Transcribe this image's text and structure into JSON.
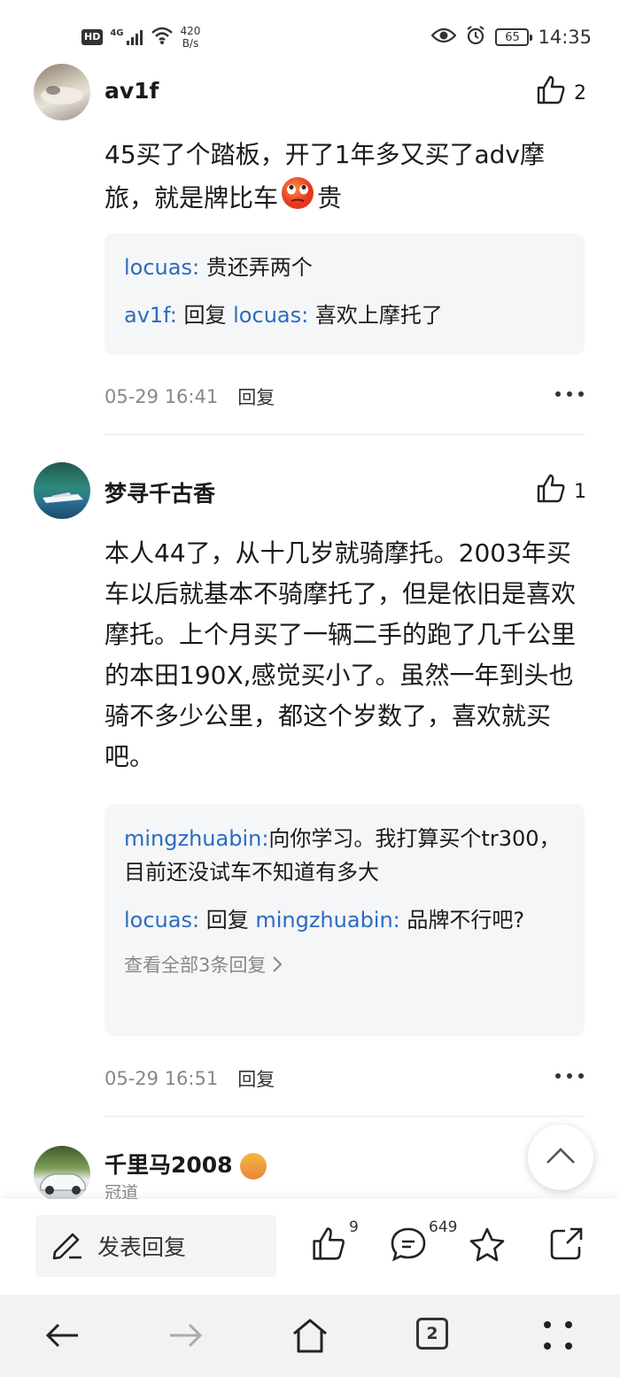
{
  "status_bar": {
    "hd": "HD",
    "signal": "4G",
    "speed_value": "420",
    "speed_unit": "B/s",
    "battery": "65",
    "time": "14:35"
  },
  "comments": [
    {
      "username": "av1f",
      "likes": "2",
      "text_before_emoji": "45买了个踏板，开了1年多又买了adv摩旅，就是牌比车",
      "text_after_emoji": "贵",
      "replies": [
        {
          "user": "locuas:",
          "reply_word": "",
          "to": "",
          "text": "贵还弄两个"
        },
        {
          "user": "av1f:",
          "reply_word": "回复",
          "to": "locuas:",
          "text": "喜欢上摩托了"
        }
      ],
      "time": "05-29 16:41",
      "reply_label": "回复"
    },
    {
      "username": "梦寻千古香",
      "likes": "1",
      "text": "本人44了，从十几岁就骑摩托。2003年买车以后就基本不骑摩托了，但是依旧是喜欢摩托。上个月买了一辆二手的跑了几千公里的本田190X,感觉买小了。虽然一年到头也骑不多少公里，都这个岁数了，喜欢就买吧。",
      "replies": [
        {
          "user": "mingzhuabin:",
          "reply_word": "",
          "to": "",
          "text": "向你学习。我打算买个tr300，目前还没试车不知道有多大"
        },
        {
          "user": "locuas:",
          "reply_word": "回复",
          "to": "mingzhuabin:",
          "text": "品牌不行吧?"
        }
      ],
      "view_all": "查看全部3条回复",
      "time": "05-29 16:51",
      "reply_label": "回复"
    },
    {
      "username": "千里马2008",
      "sub": "冠道"
    }
  ],
  "action_bar": {
    "reply_placeholder": "发表回复",
    "like_count": "9",
    "comment_count": "649"
  },
  "nav": {
    "tab_count": "2"
  },
  "colors": {
    "link": "#2c6cbf",
    "meta": "#888888",
    "reply_bg": "#f5f6f8"
  }
}
